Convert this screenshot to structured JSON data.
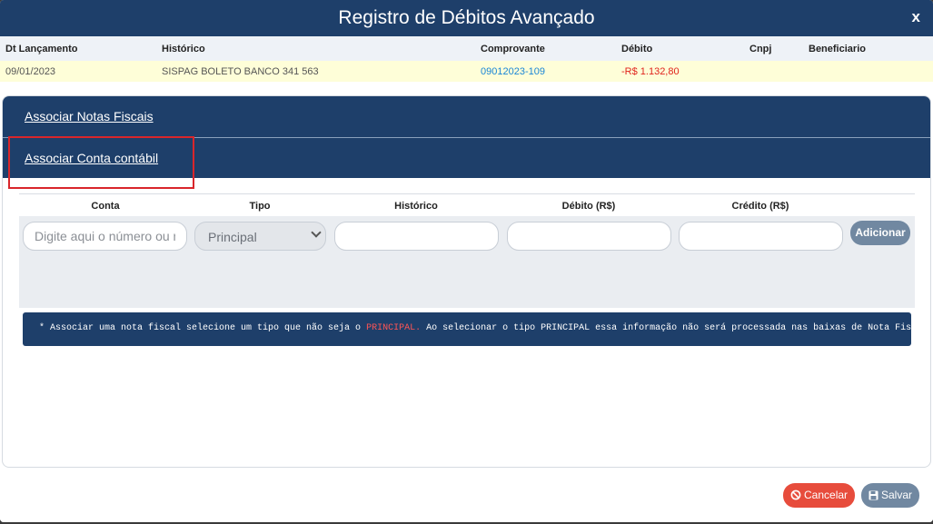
{
  "header": {
    "title": "Registro de Débitos Avançado",
    "close": "x"
  },
  "grid": {
    "columns": [
      "Dt Lançamento",
      "Histórico",
      "Comprovante",
      "Débito",
      "Cnpj",
      "Beneficiario"
    ],
    "row": {
      "dt_lancamento": "09/01/2023",
      "historico": "SISPAG BOLETO BANCO 341 563",
      "comprovante": "09012023-109",
      "debito": "-R$ 1.132,80",
      "cnpj": "",
      "beneficiario": ""
    }
  },
  "accordion": {
    "notas_fiscais": "Associar Notas Fiscais",
    "conta_contabil": "Associar Conta contábil"
  },
  "form": {
    "headers": {
      "conta": "Conta",
      "tipo": "Tipo",
      "historico": "Histórico",
      "debito": "Débito (R$)",
      "credito": "Crédito (R$)"
    },
    "conta_placeholder": "Digite aqui o número ou nome",
    "tipo_selected": "Principal",
    "historico_value": "",
    "debito_value": "",
    "credito_value": "",
    "add_button": "Adicionar"
  },
  "note": {
    "prefix": "* Associar uma nota fiscal selecione um tipo que não seja o ",
    "highlight": "PRINCIPAL.",
    "suffix": " Ao selecionar o tipo PRINCIPAL essa informação não será processada nas baixas de Nota Fiscais"
  },
  "footer": {
    "cancel": "Cancelar",
    "save": "Salvar"
  },
  "colors": {
    "navy": "#1e3f6a",
    "danger": "#e74c3c",
    "muted_button": "#7188a1",
    "row_highlight": "#fefed8"
  }
}
